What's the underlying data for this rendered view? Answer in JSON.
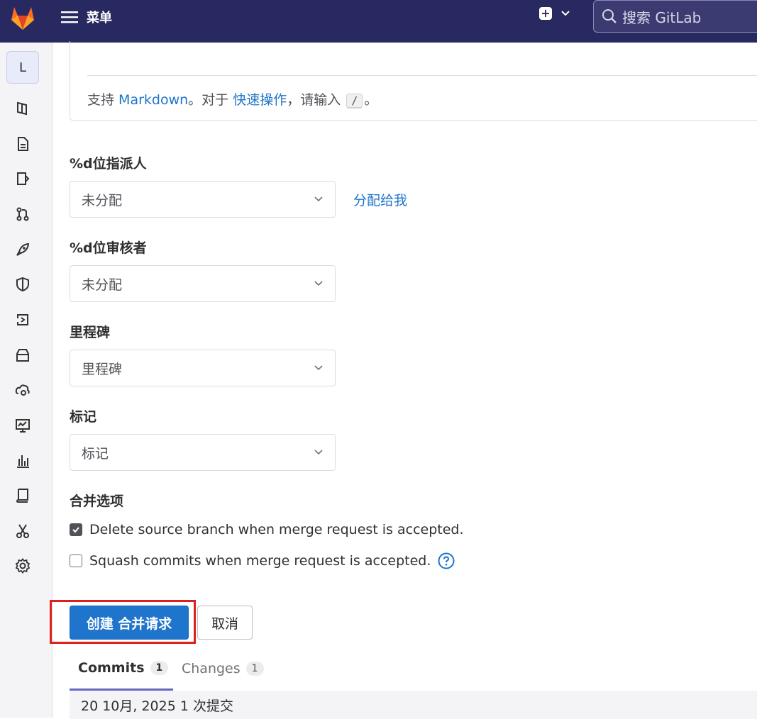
{
  "topbar": {
    "menu_label": "菜单",
    "search_placeholder": "搜索 GitLab",
    "colors": {
      "bg": "#292961",
      "logo_orange": "#e24329"
    }
  },
  "sidebar": {
    "avatar_letter": "L",
    "icons": [
      "project-overview-icon",
      "repository-file-icon",
      "issues-icon",
      "merge-requests-icon",
      "ci-cd-rocket-icon",
      "security-shield-icon",
      "deployments-icon",
      "packages-icon",
      "infrastructure-cloud-icon",
      "monitor-icon",
      "analytics-icon",
      "wiki-book-icon",
      "snippets-scissors-icon",
      "settings-gear-icon"
    ]
  },
  "editor": {
    "hint_prefix": "支持 ",
    "markdown_link": "Markdown",
    "hint_mid": "。对于 ",
    "quick_actions_link": "快速操作",
    "hint_suffix": "，请输入 ",
    "kbd": "/",
    "hint_end": "。"
  },
  "assignee": {
    "label": "%d位指派人",
    "value": "未分配",
    "assign_me": "分配给我"
  },
  "reviewer": {
    "label": "%d位审核者",
    "value": "未分配"
  },
  "milestone": {
    "label": "里程碑",
    "value": "里程碑"
  },
  "labels": {
    "label": "标记",
    "value": "标记"
  },
  "merge_options": {
    "label": "合并选项",
    "delete_branch": {
      "text": "Delete source branch when merge request is accepted.",
      "checked": true
    },
    "squash": {
      "text": "Squash commits when merge request is accepted.",
      "checked": false
    }
  },
  "actions": {
    "create": "创建 合并请求",
    "cancel": "取消"
  },
  "tabs": [
    {
      "label": "Commits",
      "count": "1",
      "active": true
    },
    {
      "label": "Changes",
      "count": "1",
      "active": false
    }
  ],
  "commit_summary": "20 10月, 2025 1 次提交",
  "accent_color": "#1f75cb"
}
